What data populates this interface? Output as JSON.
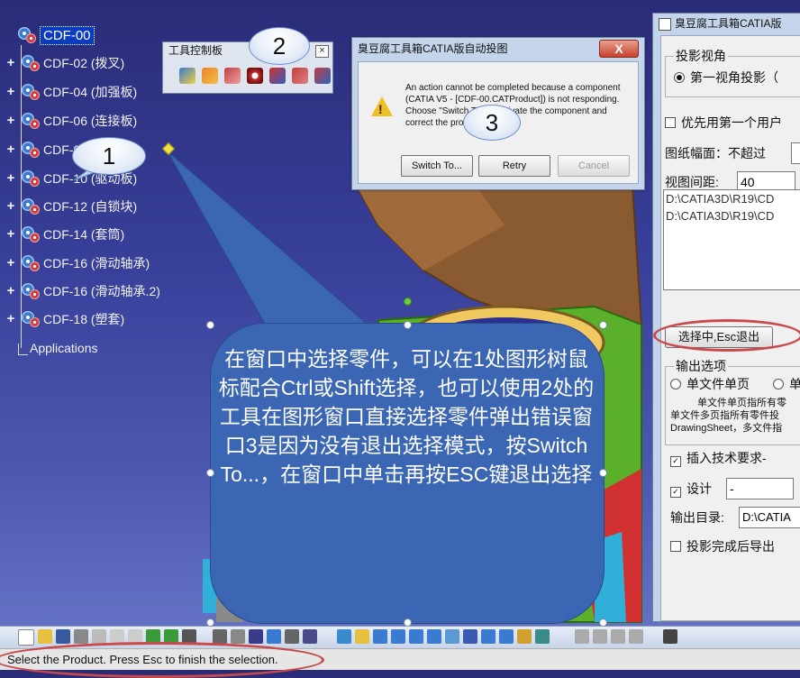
{
  "tree": {
    "root": "CDF-00",
    "items": [
      "CDF-02 (拨叉)",
      "CDF-04 (加强板)",
      "CDF-06 (连接板)",
      "CDF-08 (立板)",
      "CDF-10 (驱动板)",
      "CDF-12 (自锁块)",
      "CDF-14 (套筒)",
      "CDF-16 (滑动轴承)",
      "CDF-16 (滑动轴承.2)",
      "CDF-18 (塑套)"
    ],
    "applications": "Applications"
  },
  "tool_panel": {
    "title": "工具控制板",
    "close": "×"
  },
  "dialog": {
    "title": "臭豆腐工具箱CATIA版自动投图",
    "close": "X",
    "message": "An action cannot be completed because a component (CATIA V5 - [CDF-00.CATProduct]) is not responding. Choose \"Switch To\" to activate the component and correct the problem.",
    "switch_btn": "Switch To...",
    "retry_btn": "Retry",
    "cancel_btn": "Cancel"
  },
  "right_window": {
    "title": "臭豆腐工具箱CATIA版",
    "projection_group": "投影视角",
    "first_angle": "第一视角投影（",
    "prefer_user": "优先用第一个用户",
    "paper_label": "图纸幅面：不超过",
    "spacing_label": "视图间距:",
    "spacing_value": "40",
    "paths": [
      "D:\\CATIA3D\\R19\\CD",
      "D:\\CATIA3D\\R19\\CD"
    ],
    "select_btn": "选择中,Esc退出",
    "output_group": "输出选项",
    "single_page": "单文件单页",
    "single_page_other": "单",
    "desc1": "单文件单页指所有零",
    "desc2": "单文件多页指所有零件投",
    "desc3": "DrawingSheet，多文件指",
    "insert_tech": "插入技术要求-",
    "design_label": "设计",
    "design_value": "-",
    "output_dir_label": "输出目录:",
    "output_dir_value": "D:\\CATIA",
    "export_after": "投影完成后导出"
  },
  "callouts": {
    "one": "1",
    "two": "2",
    "three": "3",
    "main_text": "在窗口中选择零件，可以在1处图形树鼠标配合Ctrl或Shift选择，也可以使用2处的工具在图形窗口直接选择零件弹出错误窗口3是因为没有退出选择模式，按Switch To...，在窗口中单击再按ESC键退出选择"
  },
  "status": "Select the Product. Press Esc to finish the selection."
}
